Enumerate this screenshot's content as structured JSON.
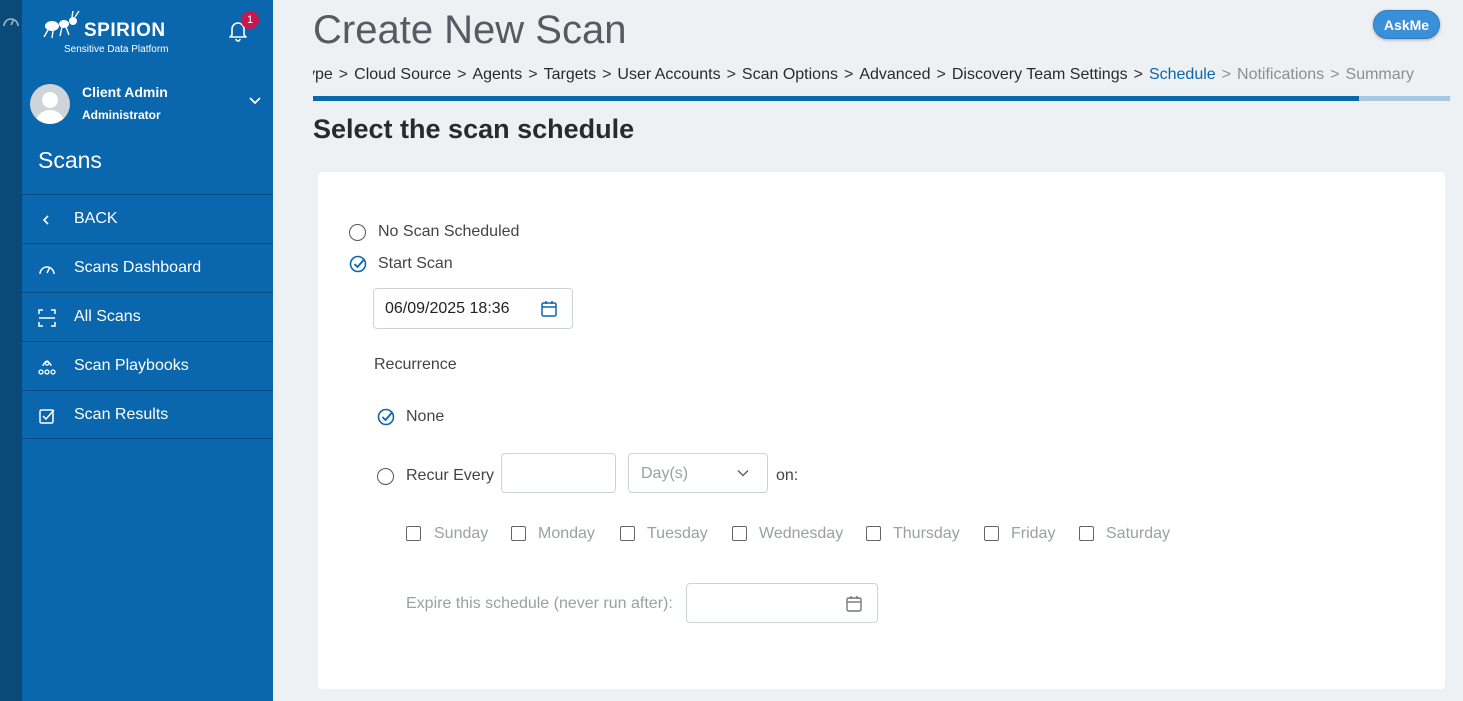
{
  "sidebar": {
    "brand": "SPIRION",
    "brand_sub": "Sensitive Data Platform",
    "notification_count": "1",
    "user_name": "Client Admin",
    "user_role": "Administrator",
    "section_title": "Scans",
    "items": [
      {
        "label": "BACK",
        "icon": "chevron-left-icon"
      },
      {
        "label": "Scans Dashboard",
        "icon": "dashboard-gauge-icon"
      },
      {
        "label": "All Scans",
        "icon": "scan-frame-icon"
      },
      {
        "label": "Scan Playbooks",
        "icon": "playbook-icon"
      },
      {
        "label": "Scan Results",
        "icon": "checkbox-check-icon"
      }
    ]
  },
  "header": {
    "title": "Create New Scan",
    "askme_label": "AskMe"
  },
  "wizard": {
    "steps": [
      {
        "label": "ype",
        "state": "done"
      },
      {
        "label": "Cloud Source",
        "state": "done"
      },
      {
        "label": "Agents",
        "state": "done"
      },
      {
        "label": "Targets",
        "state": "done"
      },
      {
        "label": "User Accounts",
        "state": "done"
      },
      {
        "label": "Scan Options",
        "state": "done"
      },
      {
        "label": "Advanced",
        "state": "done"
      },
      {
        "label": "Discovery Team Settings",
        "state": "done"
      },
      {
        "label": "Schedule",
        "state": "active"
      },
      {
        "label": "Notifications",
        "state": "future"
      },
      {
        "label": "Summary",
        "state": "future"
      }
    ],
    "separator": ">",
    "progress_fraction": 0.92
  },
  "schedule": {
    "heading": "Select the scan schedule",
    "option_no_scan": "No Scan Scheduled",
    "option_start_scan": "Start Scan",
    "start_datetime": "06/09/2025 18:36",
    "recurrence_label": "Recurrence",
    "recur_none": "None",
    "recur_every": "Recur Every",
    "recur_count": "",
    "recur_unit_placeholder": "Day(s)",
    "on_label": "on:",
    "days": [
      "Sunday",
      "Monday",
      "Tuesday",
      "Wednesday",
      "Thursday",
      "Friday",
      "Saturday"
    ],
    "expire_label": "Expire this schedule (never run after):",
    "expire_value": ""
  },
  "colors": {
    "sidebar": "#0a66ad",
    "rail": "#0b4a78",
    "accent": "#0a66ad",
    "badge": "#c8174f",
    "askme": "#3a8fd9"
  }
}
